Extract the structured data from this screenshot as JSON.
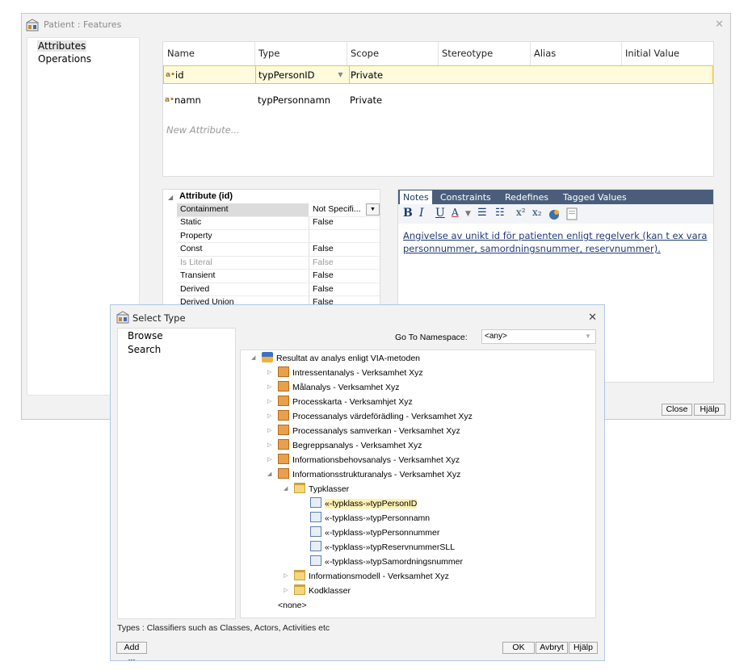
{
  "main_window": {
    "title": "Patient : Features",
    "nav": [
      "Attributes",
      "Operations"
    ],
    "grid": {
      "headers": [
        "Name",
        "Type",
        "Scope",
        "Stereotype",
        "Alias",
        "Initial Value"
      ],
      "rows": [
        {
          "name": "id",
          "type": "typPersonID",
          "scope": "Private"
        },
        {
          "name": "namn",
          "type": "typPersonnamn",
          "scope": "Private"
        }
      ],
      "new_placeholder": "New Attribute..."
    },
    "properties": {
      "group": "Attribute (id)",
      "rows": [
        {
          "key": "Containment",
          "value": "Not Specifi..."
        },
        {
          "key": "Static",
          "value": "False"
        },
        {
          "key": "Property",
          "value": ""
        },
        {
          "key": "Const",
          "value": "False"
        },
        {
          "key": "Is Literal",
          "value": "False"
        },
        {
          "key": "Transient",
          "value": "False"
        },
        {
          "key": "Derived",
          "value": "False"
        },
        {
          "key": "Derived Union",
          "value": "False"
        }
      ]
    },
    "notes": {
      "tabs": [
        "Notes",
        "Constraints",
        "Redefines",
        "Tagged Values"
      ],
      "text": "Angivelse av unikt id för patienten enligt regelverk (kan t ex vara personnummer, samordningsnummer, reservnummer)."
    },
    "buttons": {
      "close": "Close",
      "help": "Hjälp"
    }
  },
  "dialog": {
    "title": "Select Type",
    "nav": [
      "Browse",
      "Search"
    ],
    "namespace_label": "Go To Namespace:",
    "namespace_value": "<any>",
    "tree": [
      {
        "label": "Resultat av analys enligt VIA-metoden",
        "icon": "package-icon",
        "expander": "expanded"
      },
      {
        "label": "Intressentanalys - Verksamhet Xyz",
        "icon": "diagram-icon",
        "expander": "collapsed"
      },
      {
        "label": "Målanalys - Verksamhet Xyz",
        "icon": "diagram-icon",
        "expander": "collapsed"
      },
      {
        "label": "Processkarta - Verksamhjet Xyz",
        "icon": "diagram-icon",
        "expander": "collapsed"
      },
      {
        "label": "Processanalys värdeförädling - Verksamhet Xyz",
        "icon": "diagram-icon",
        "expander": "collapsed"
      },
      {
        "label": "Processanalys samverkan - Verksamhet Xyz",
        "icon": "diagram-icon",
        "expander": "collapsed"
      },
      {
        "label": "Begreppsanalys - Verksamhet Xyz",
        "icon": "diagram-icon",
        "expander": "collapsed"
      },
      {
        "label": "Informationsbehovsanalys - Verksamhet Xyz",
        "icon": "diagram-icon",
        "expander": "collapsed"
      },
      {
        "label": "Informationsstrukturanalys - Verksamhet Xyz",
        "icon": "diagram-icon",
        "expander": "expanded"
      },
      {
        "label": "Typklasser",
        "icon": "folder-icon",
        "expander": "expanded"
      },
      {
        "label": "«-typklass-»typPersonID",
        "icon": "class-icon",
        "selected": true
      },
      {
        "label": "«-typklass-»typPersonnamn",
        "icon": "class-icon"
      },
      {
        "label": "«-typklass-»typPersonnummer",
        "icon": "class-icon"
      },
      {
        "label": "«-typklass-»typReservnummerSLL",
        "icon": "class-icon"
      },
      {
        "label": "«-typklass-»typSamordningsnummer",
        "icon": "class-icon"
      },
      {
        "label": "Informationsmodell - Verksamhet Xyz",
        "icon": "folder-icon",
        "expander": "collapsed"
      },
      {
        "label": "Kodklasser",
        "icon": "folder-icon",
        "expander": "collapsed"
      },
      {
        "label": "<none>",
        "icon": ""
      }
    ],
    "status": "Types : Classifiers such as Classes, Actors, Activities etc",
    "buttons": {
      "add": "Add ...",
      "ok": "OK",
      "cancel": "Avbryt",
      "help": "Hjälp"
    }
  }
}
